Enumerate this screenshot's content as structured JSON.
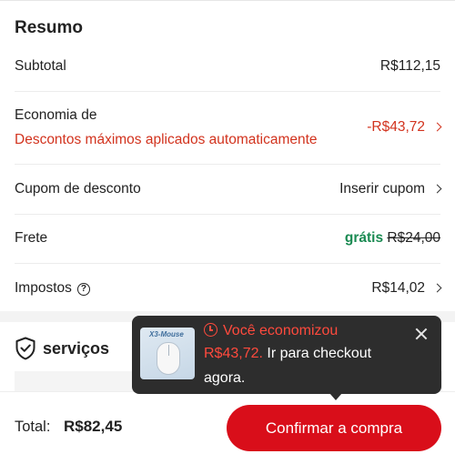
{
  "summary": {
    "title": "Resumo",
    "subtotal_label": "Subtotal",
    "subtotal_value": "R$112,15",
    "savings_label": "Economia de",
    "savings_note": "Descontos máximos aplicados automaticamente",
    "savings_value": "-R$43,72",
    "coupon_label": "Cupom de desconto",
    "coupon_action": "Inserir cupom",
    "shipping_label": "Frete",
    "shipping_free": "grátis",
    "shipping_original": "R$24,00",
    "taxes_label": "Impostos",
    "taxes_value": "R$14,02",
    "help_glyph": "?"
  },
  "services": {
    "title": "serviços",
    "icon": "shield-check-icon"
  },
  "toast": {
    "line1": "Você economizou",
    "amount": "R$43,72.",
    "line2_rest": " Ir para checkout",
    "line3": "agora.",
    "thumbnail_text": "X3-Mouse"
  },
  "footer": {
    "total_label": "Total:",
    "total_value": "R$82,45",
    "confirm_label": "Confirmar a compra"
  },
  "colors": {
    "accent_red": "#d90e1a",
    "savings_red": "#d2331e",
    "free_green": "#1a8a52",
    "toast_bg": "#2d2d2d"
  }
}
